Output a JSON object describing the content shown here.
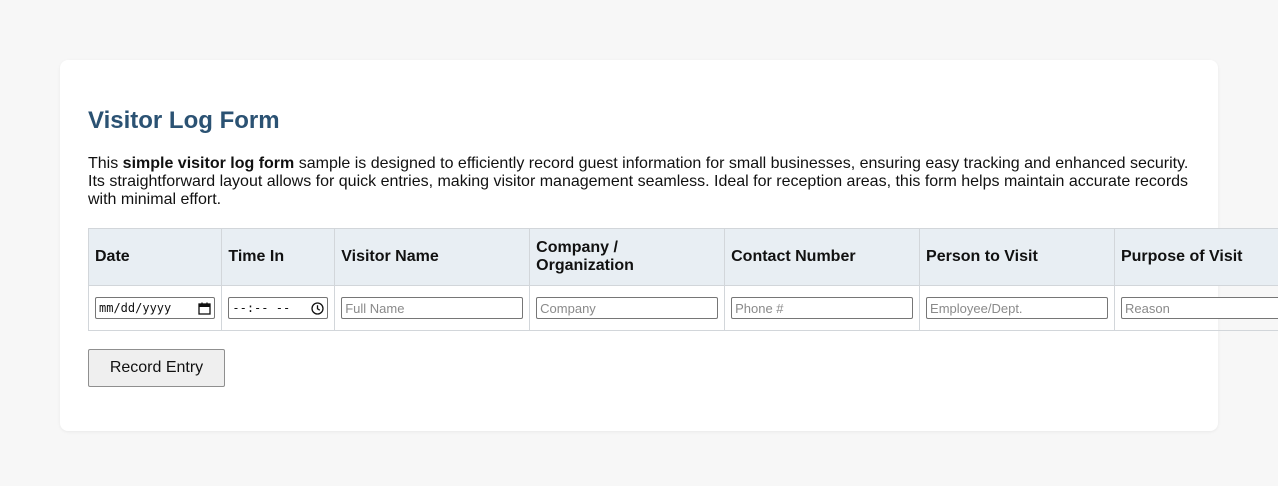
{
  "form": {
    "title": "Visitor Log Form",
    "intro": {
      "prefix": "This ",
      "bold": "simple visitor log form",
      "suffix": " sample is designed to efficiently record guest information for small businesses, ensuring easy tracking and enhanced security. Its straightforward layout allows for quick entries, making visitor management seamless. Ideal for reception areas, this form helps maintain accurate records with minimal effort."
    },
    "columns": [
      "Date",
      "Time In",
      "Visitor Name",
      "Company / Organization",
      "Contact Number",
      "Person to Visit",
      "Purpose of Visit"
    ],
    "row": {
      "date_value": "mm/dd/yyyy",
      "time_value": "--:-- --",
      "visitor_name_placeholder": "Full Name",
      "company_placeholder": "Company",
      "contact_placeholder": "Phone #",
      "person_placeholder": "Employee/Dept.",
      "purpose_placeholder": "Reason"
    },
    "submit_label": "Record Entry",
    "icons": {
      "date": "calendar-icon",
      "time": "clock-icon"
    },
    "colors": {
      "title": "#2b5273",
      "header_bg": "#e8eef3",
      "page_bg": "#f7f7f7",
      "card_bg": "#ffffff"
    }
  }
}
